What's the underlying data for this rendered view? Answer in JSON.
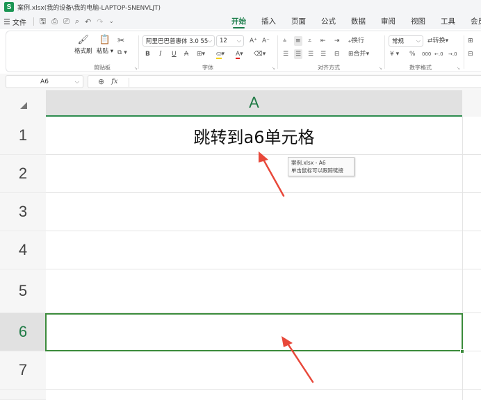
{
  "window": {
    "title": "案例.xlsx(我的设备\\我的电脑-LAPTOP-SNENVLJT)",
    "app_logo": "S"
  },
  "menubar": {
    "file_label": "文件",
    "tabs": [
      {
        "label": "开始",
        "active": true
      },
      {
        "label": "插入",
        "active": false
      },
      {
        "label": "页面",
        "active": false
      },
      {
        "label": "公式",
        "active": false
      },
      {
        "label": "数据",
        "active": false
      },
      {
        "label": "审阅",
        "active": false
      },
      {
        "label": "视图",
        "active": false
      },
      {
        "label": "工具",
        "active": false
      },
      {
        "label": "会员专享",
        "active": false
      }
    ]
  },
  "ribbon": {
    "clipboard": {
      "format_painter": "格式刷",
      "paste": "粘贴",
      "label": "剪贴板"
    },
    "font": {
      "name": "阿里巴巴普惠体 3.0 55",
      "size": "12",
      "label": "字体"
    },
    "alignment": {
      "wrap": "换行",
      "merge": "合并",
      "label": "对齐方式"
    },
    "number": {
      "format": "常规",
      "convert": "转换",
      "label": "数字格式"
    }
  },
  "formula_bar": {
    "name_box": "A6",
    "fx": "fx"
  },
  "sheet": {
    "column_header": "A",
    "rows": [
      "1",
      "2",
      "3",
      "4",
      "5",
      "6",
      "7"
    ],
    "selected_row": "6",
    "cell_a1": "跳转到a6单元格"
  },
  "tooltip": {
    "line1": "案例.xlsx - A6",
    "line2": "单击鼠标可以跟踪链接"
  },
  "colors": {
    "accent": "#1a7d4a",
    "selection": "#3b8b3b",
    "arrow": "#e8483a"
  }
}
